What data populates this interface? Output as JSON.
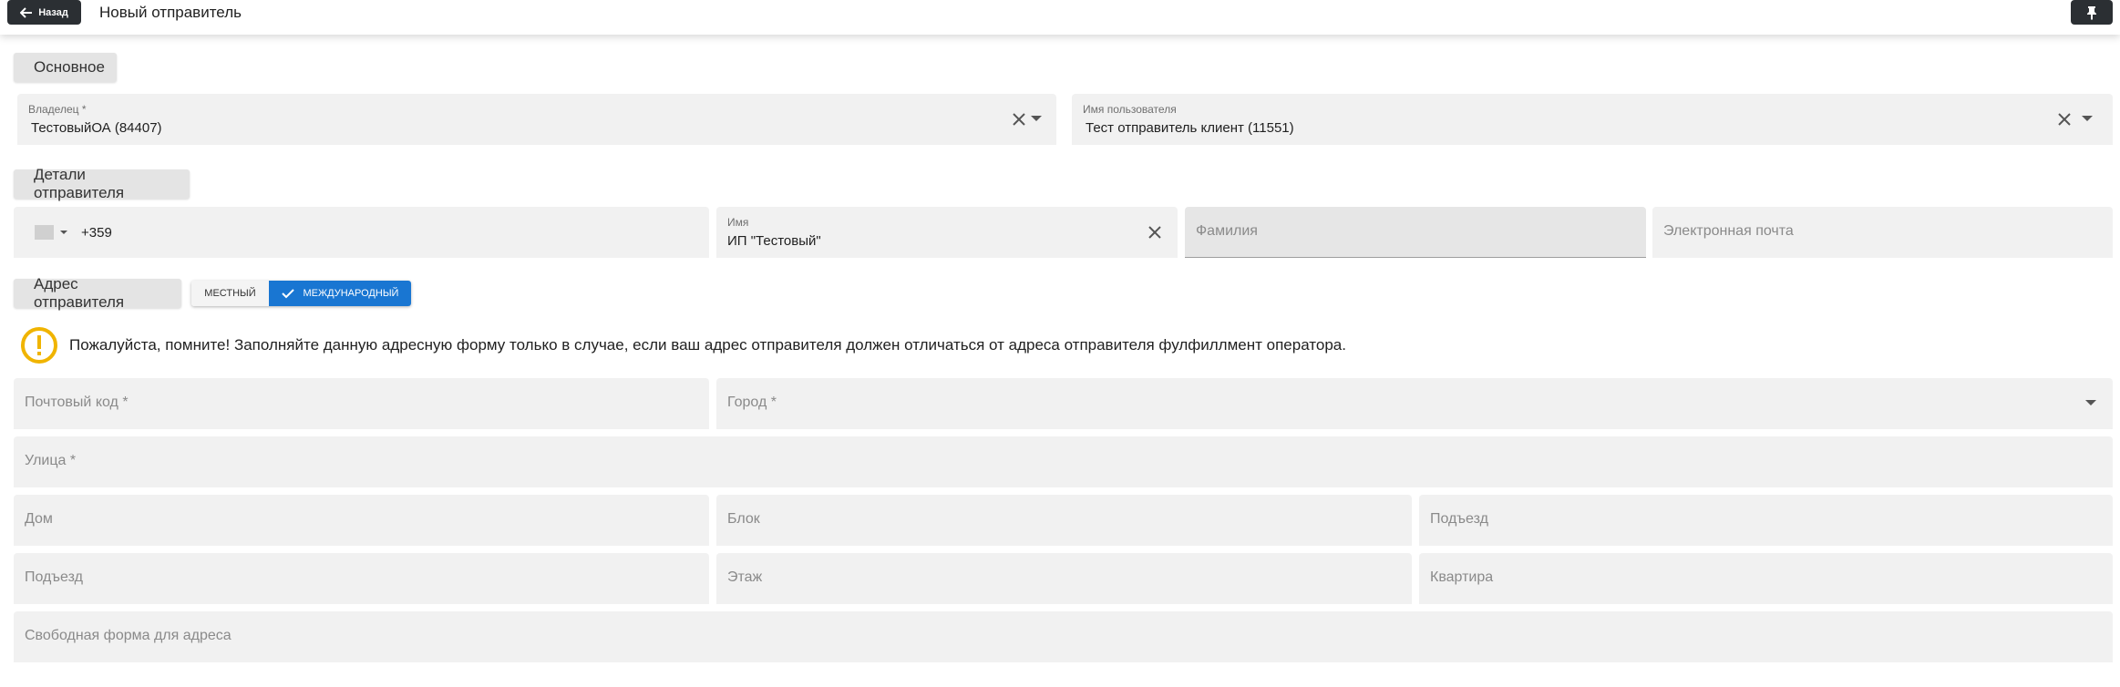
{
  "header": {
    "back_label": "Назад",
    "title": "Новый отправитель",
    "back_icon": "arrow-left-icon",
    "pin_icon": "pin-icon"
  },
  "sections": {
    "basic": "Основное",
    "sender_details": "Детали отправителя",
    "sender_address": "Адрес отправителя"
  },
  "basic": {
    "owner": {
      "label": "Владелец *",
      "value": "ТестовыйОА (84407)"
    },
    "username": {
      "label": "Имя пользователя",
      "value": "Тест отправитель клиент (11551)"
    }
  },
  "details": {
    "phone": {
      "value": "+359"
    },
    "name": {
      "label": "Имя",
      "value": "ИП \"Тестовый\""
    },
    "surname": {
      "placeholder": "Фамилия"
    },
    "email": {
      "placeholder": "Электронная почта"
    }
  },
  "address_toggle": {
    "local": "МЕСТНЫЙ",
    "international": "МЕЖДУНАРОДНЫЙ",
    "selected": "international"
  },
  "notice": {
    "text": "Пожалуйста, помните! Заполняйте данную адресную форму только в случае, если ваш адрес отправителя должен отличаться от адреса отправителя фулфиллмент оператора.",
    "icon": "warning-circle-icon",
    "color": "#f0b400"
  },
  "address": {
    "postal_code": "Почтовый код *",
    "city": "Город *",
    "street": "Улица *",
    "house": "Дом",
    "block": "Блок",
    "entrance1": "Подъезд",
    "entrance2": "Подъезд",
    "floor": "Этаж",
    "apartment": "Квартира",
    "free_form": "Свободная форма для адреса"
  },
  "colors": {
    "accent": "#1976d2",
    "dark_button": "#2b2f33",
    "field_bg": "#f1f1f1"
  }
}
